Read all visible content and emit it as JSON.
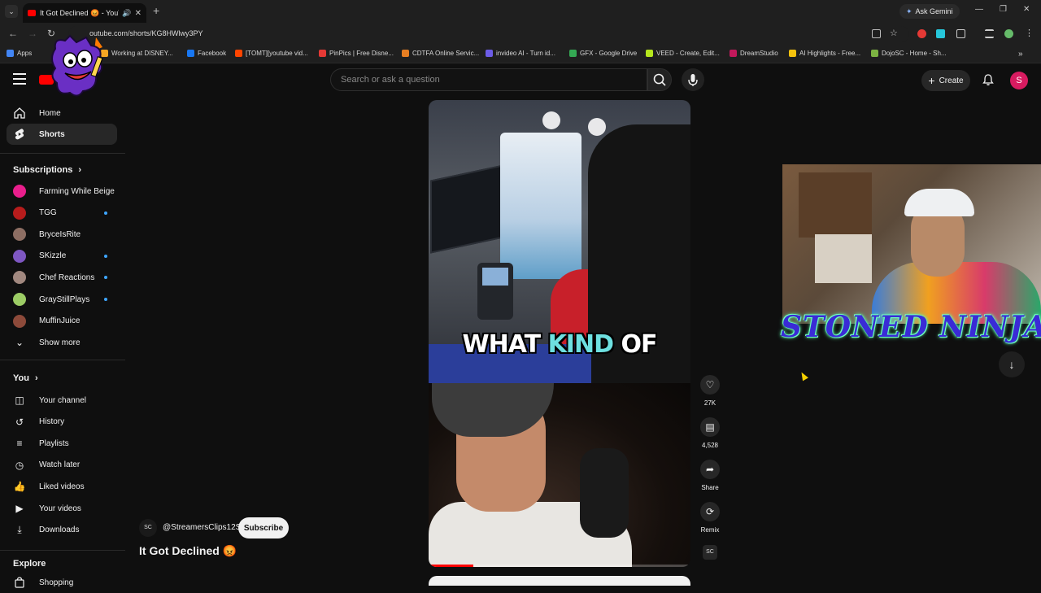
{
  "browser": {
    "tab_title": "It Got Declined 😡 - YouTube",
    "url": "outube.com/shorts/KG8HWlwy3PY",
    "ask_gemini": "Ask Gemini",
    "bookmarks": [
      {
        "label": "Apps",
        "color": "#4285f4"
      },
      {
        "label": "Working at DISNEY...",
        "color": "#f5a623"
      },
      {
        "label": "Facebook",
        "color": "#1877f2"
      },
      {
        "label": "[TOMT][youtube vid...",
        "color": "#ff4500"
      },
      {
        "label": "PinPics | Free Disne...",
        "color": "#e53935"
      },
      {
        "label": "CDTFA Online Servic...",
        "color": "#e67e22"
      },
      {
        "label": "invideo AI - Turn id...",
        "color": "#6c5ce7"
      },
      {
        "label": "GFX - Google Drive",
        "color": "#34a853"
      },
      {
        "label": "VEED - Create, Edit...",
        "color": "#b5e61d"
      },
      {
        "label": "DreamStudio",
        "color": "#c2185b"
      },
      {
        "label": "AI Highlights - Free...",
        "color": "#f4c20d"
      },
      {
        "label": "DojoSC - Home - Sh...",
        "color": "#7cb342"
      }
    ]
  },
  "header": {
    "search_placeholder": "Search or ask a question",
    "create_label": "Create",
    "avatar_letter": "S"
  },
  "sidebar": {
    "main": [
      {
        "label": "Home",
        "icon": "home-icon",
        "glyph": "⌂"
      },
      {
        "label": "Shorts",
        "icon": "shorts-icon",
        "glyph": "ϟ",
        "active": true
      }
    ],
    "subscriptions_heading": "Subscriptions",
    "subscriptions": [
      {
        "label": "Farming While Beige",
        "color": "#e91e8c",
        "dot": false
      },
      {
        "label": "TGG",
        "color": "#b71c1c",
        "dot": true
      },
      {
        "label": "BryceIsRite",
        "color": "#8d6e63",
        "dot": false
      },
      {
        "label": "SKizzle",
        "color": "#7e57c2",
        "dot": true
      },
      {
        "label": "Chef Reactions",
        "color": "#a1887f",
        "dot": true
      },
      {
        "label": "GrayStillPlays",
        "color": "#9ccc65",
        "dot": true
      },
      {
        "label": "MuffinJuice",
        "color": "#8d4a3a",
        "dot": false
      }
    ],
    "show_more": "Show more",
    "you_heading": "You",
    "you_items": [
      {
        "label": "Your channel",
        "icon": "channel-icon",
        "glyph": "◫"
      },
      {
        "label": "History",
        "icon": "history-icon",
        "glyph": "↺"
      },
      {
        "label": "Playlists",
        "icon": "playlists-icon",
        "glyph": "≡"
      },
      {
        "label": "Watch later",
        "icon": "watch-later-icon",
        "glyph": "◷"
      },
      {
        "label": "Liked videos",
        "icon": "like-icon",
        "glyph": "👍"
      },
      {
        "label": "Your videos",
        "icon": "your-videos-icon",
        "glyph": "▶"
      },
      {
        "label": "Downloads",
        "icon": "download-icon",
        "glyph": "⤓"
      }
    ],
    "explore_heading": "Explore",
    "explore_items": [
      {
        "label": "Shopping",
        "icon": "shopping-icon",
        "glyph": "🛍"
      }
    ]
  },
  "short": {
    "caption_before": "WHAT",
    "caption_highlight": "KIND",
    "caption_after": "OF",
    "progress": 0.17
  },
  "actions": {
    "likes": "27K",
    "comments": "4,528",
    "share": "Share",
    "remix": "Remix",
    "sc": "SC"
  },
  "channel": {
    "avatar": "SC",
    "handle": "@StreamersClips12S",
    "subscribe_label": "Subscribe",
    "title": "It Got Declined 😡"
  },
  "overlay": {
    "ninja_text": "STONED NINJA"
  }
}
